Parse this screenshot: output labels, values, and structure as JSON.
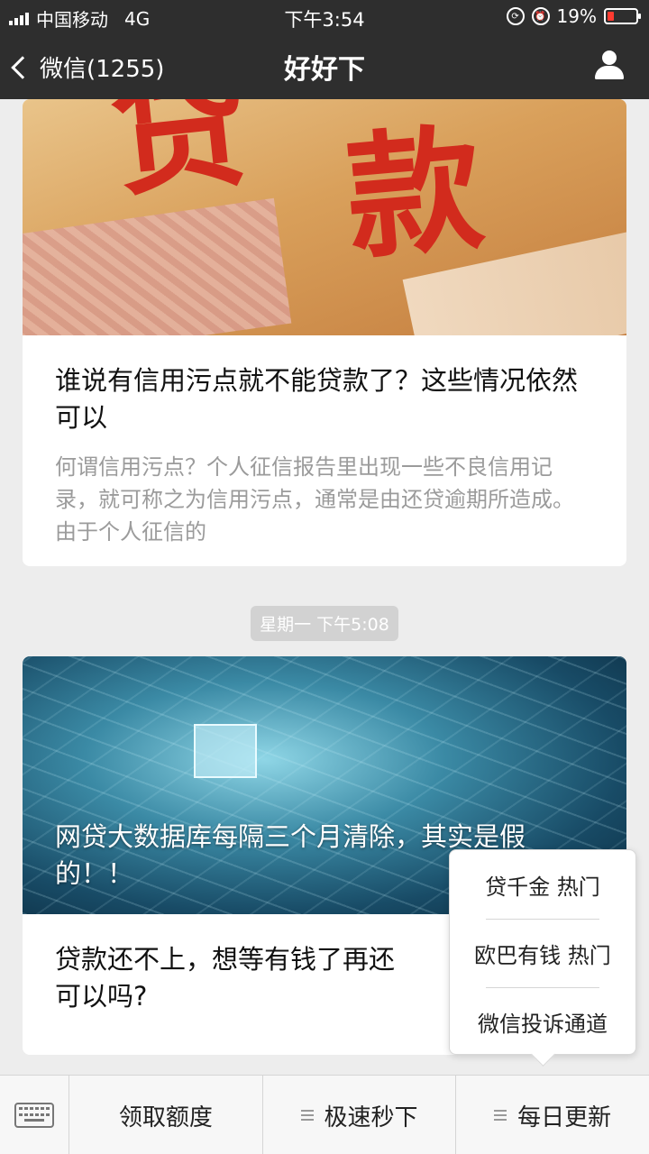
{
  "status_bar": {
    "carrier": "中国移动",
    "network": "4G",
    "time": "下午3:54",
    "battery": "19%"
  },
  "nav": {
    "back_label": "微信(1255)",
    "title": "好好下"
  },
  "card1": {
    "title": "谁说有信用污点就不能贷款了？这些情况依然可以",
    "description": "何谓信用污点？个人征信报告里出现一些不良信用记录，就可称之为信用污点，通常是由还贷逾期所造成。由于个人征信的",
    "image_text": [
      "贷",
      "款"
    ]
  },
  "timestamp": "星期一 下午5:08",
  "card2": {
    "image_title": "网贷大数据库每隔三个月清除，其实是假的！！",
    "title": "贷款还不上，想等有钱了再还可以吗?"
  },
  "popup_menu": {
    "items": [
      "贷千金 热门",
      "欧巴有钱 热门",
      "微信投诉通道"
    ]
  },
  "bottom_menu": {
    "items": [
      "领取额度",
      "极速秒下",
      "每日更新"
    ]
  },
  "colors": {
    "nav_bg": "#2e2e2e",
    "page_bg": "#ededed",
    "battery_low": "#ff3b30"
  }
}
